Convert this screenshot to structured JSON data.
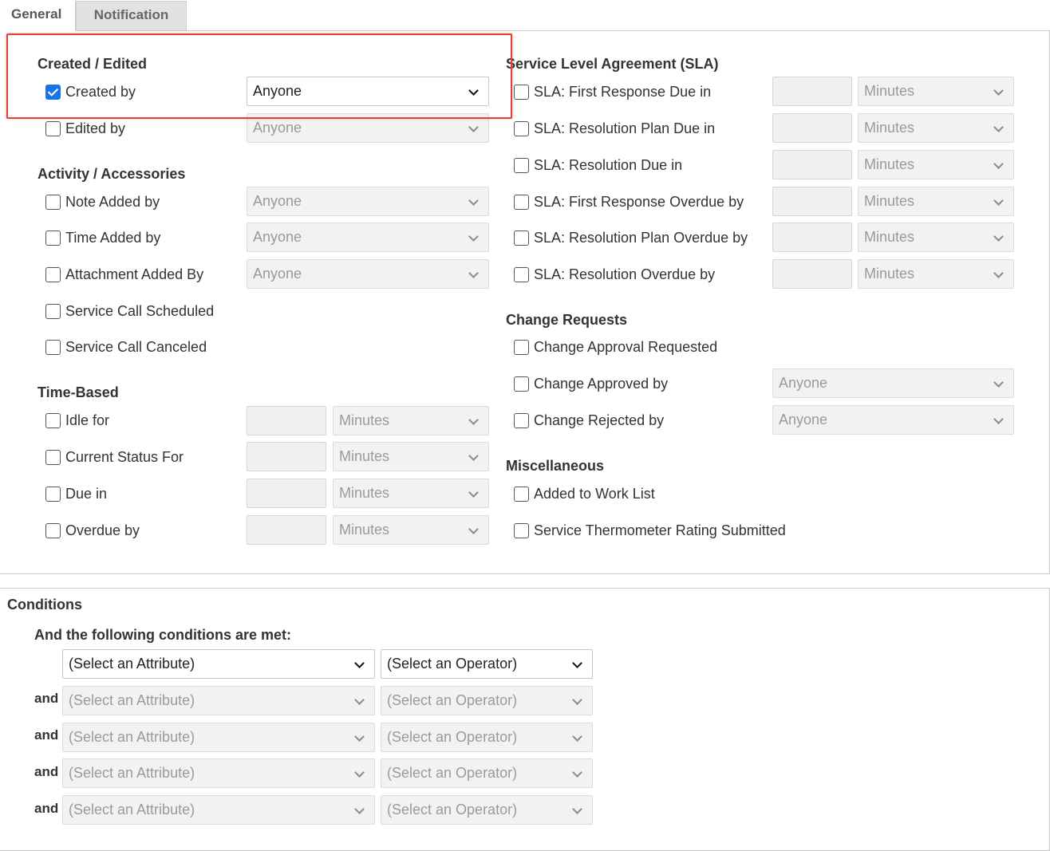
{
  "tabs": [
    {
      "label": "General"
    },
    {
      "label": "Notification"
    }
  ],
  "created_edited": {
    "heading": "Created / Edited",
    "created_by": {
      "label": "Created by",
      "checked": true,
      "value": "Anyone"
    },
    "edited_by": {
      "label": "Edited by",
      "checked": false,
      "value": "Anyone"
    }
  },
  "activity": {
    "heading": "Activity / Accessories",
    "note_added_by": {
      "label": "Note Added by",
      "value": "Anyone"
    },
    "time_added_by": {
      "label": "Time Added by",
      "value": "Anyone"
    },
    "attachment_added_by": {
      "label": "Attachment Added By",
      "value": "Anyone"
    },
    "service_call_scheduled": {
      "label": "Service Call Scheduled"
    },
    "service_call_canceled": {
      "label": "Service Call Canceled"
    }
  },
  "time_based": {
    "heading": "Time-Based",
    "idle_for": {
      "label": "Idle for",
      "unit": "Minutes"
    },
    "current_status_for": {
      "label": "Current Status For",
      "unit": "Minutes"
    },
    "due_in": {
      "label": "Due in",
      "unit": "Minutes"
    },
    "overdue_by": {
      "label": "Overdue by",
      "unit": "Minutes"
    }
  },
  "sla": {
    "heading": "Service Level Agreement (SLA)",
    "first_response_due": {
      "label": "SLA: First Response Due in",
      "unit": "Minutes"
    },
    "resolution_plan_due": {
      "label": "SLA: Resolution Plan Due in",
      "unit": "Minutes"
    },
    "resolution_due": {
      "label": "SLA: Resolution Due in",
      "unit": "Minutes"
    },
    "first_response_overdue": {
      "label": "SLA: First Response Overdue by",
      "unit": "Minutes"
    },
    "resolution_plan_overdue": {
      "label": "SLA: Resolution Plan Overdue by",
      "unit": "Minutes"
    },
    "resolution_overdue": {
      "label": "SLA: Resolution Overdue by",
      "unit": "Minutes"
    }
  },
  "change_requests": {
    "heading": "Change Requests",
    "approval_requested": {
      "label": "Change Approval Requested"
    },
    "approved_by": {
      "label": "Change Approved by",
      "value": "Anyone"
    },
    "rejected_by": {
      "label": "Change Rejected by",
      "value": "Anyone"
    }
  },
  "misc": {
    "heading": "Miscellaneous",
    "added_to_work_list": {
      "label": "Added to Work List"
    },
    "thermometer_rating": {
      "label": "Service Thermometer Rating Submitted"
    }
  },
  "conditions": {
    "heading": "Conditions",
    "subheading": "And the following conditions are met:",
    "and_label": "and",
    "attribute_placeholder": "(Select an Attribute)",
    "operator_placeholder": "(Select an Operator)"
  },
  "colors": {
    "checkbox_checked": "#1a73e8",
    "highlight_border": "#e0413a"
  }
}
